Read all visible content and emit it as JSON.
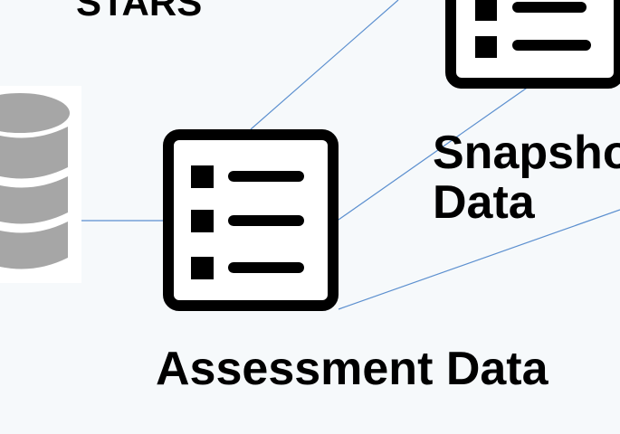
{
  "labels": {
    "stars": "STARS",
    "snapshot_data": "Snapshot Data",
    "assessment_data": "Assessment Data"
  },
  "icons": {
    "database": "database-icon",
    "assessment_document": "checklist-document-icon",
    "snapshot_document": "checklist-document-icon"
  },
  "colors": {
    "background": "#f6f9fb",
    "connector": "#5b8fcf",
    "database": "#a6a6a6",
    "document_ink": "#000000"
  }
}
